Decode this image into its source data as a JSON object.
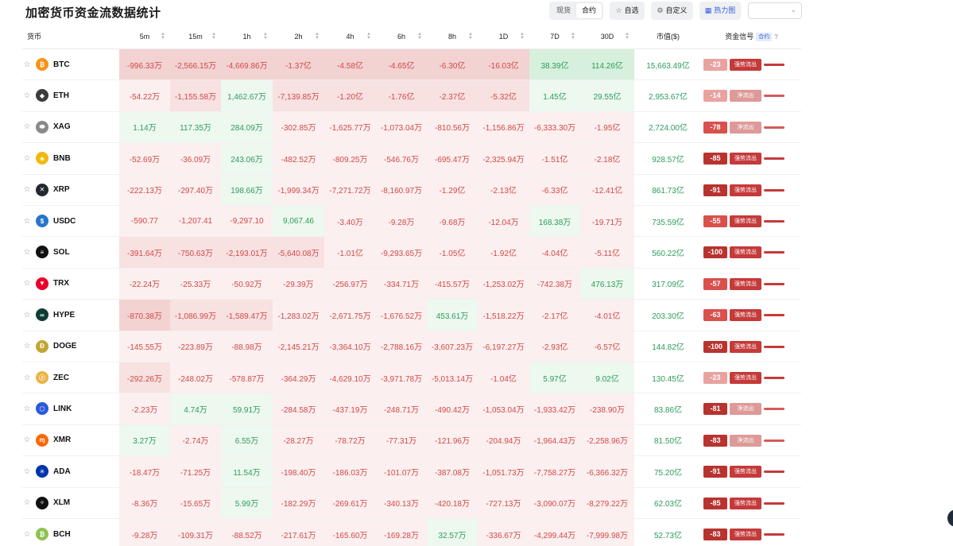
{
  "title": "加密货币资金流数据统计",
  "toolbar": {
    "seg_spot": "现货",
    "seg_contract": "合约",
    "favorites": "自选",
    "custom": "自定义",
    "heatmap": "热力图",
    "dropdown_value": ""
  },
  "columns": [
    "货币",
    "5m",
    "15m",
    "1h",
    "2h",
    "4h",
    "6h",
    "8h",
    "1D",
    "7D",
    "30D",
    "市值($)",
    "资金信号"
  ],
  "signal_badge": "合约",
  "signal_help": "?",
  "rows": [
    {
      "sym": "BTC",
      "icon": "btc",
      "color": "#f7931a",
      "v": [
        "-996.33万",
        "-2,566.15万",
        "-4,669.86万",
        "-1.37亿",
        "-4.58亿",
        "-4.65亿",
        "-6.30亿",
        "-16.03亿",
        "38.39亿",
        "114.26亿"
      ],
      "cap": "15,663.49亿",
      "score": "-23",
      "tag": "强势流出",
      "strong": true
    },
    {
      "sym": "ETH",
      "icon": "eth",
      "color": "#3c3c3d",
      "v": [
        "-54.22万",
        "-1,155.58万",
        "1,462.67万",
        "-7,139.85万",
        "-1.20亿",
        "-1.76亿",
        "-2.37亿",
        "-5.32亿",
        "1.45亿",
        "29.55亿"
      ],
      "cap": "2,953.67亿",
      "score": "-14",
      "tag": "净流出",
      "strong": false
    },
    {
      "sym": "XAG",
      "icon": "xag",
      "color": "#8a8a8a",
      "v": [
        "1.14万",
        "117.35万",
        "284.09万",
        "-302.85万",
        "-1,625.77万",
        "-1,073.04万",
        "-810.56万",
        "-1,156.86万",
        "-6,333.30万",
        "-1.95亿"
      ],
      "cap": "2,724.00亿",
      "score": "-78",
      "tag": "净流出",
      "strong": false
    },
    {
      "sym": "BNB",
      "icon": "bnb",
      "color": "#f0b90b",
      "v": [
        "-52.69万",
        "-36.09万",
        "243.06万",
        "-482.52万",
        "-809.25万",
        "-546.76万",
        "-695.47万",
        "-2,325.94万",
        "-1.51亿",
        "-2.18亿"
      ],
      "cap": "928.57亿",
      "score": "-85",
      "tag": "强势流出",
      "strong": true
    },
    {
      "sym": "XRP",
      "icon": "xrp",
      "color": "#23292f",
      "v": [
        "-222.13万",
        "-297.40万",
        "198.66万",
        "-1,999.34万",
        "-7,271.72万",
        "-8,160.97万",
        "-1.29亿",
        "-2.13亿",
        "-6.33亿",
        "-12.41亿"
      ],
      "cap": "861.73亿",
      "score": "-91",
      "tag": "强势流出",
      "strong": true
    },
    {
      "sym": "USDC",
      "icon": "usdc",
      "color": "#2775ca",
      "v": [
        "-590.77",
        "-1,207.41",
        "-9,297.10",
        "9,067.46",
        "-3.40万",
        "-9.28万",
        "-9.68万",
        "-12.04万",
        "168.38万",
        "-19.71万"
      ],
      "cap": "735.59亿",
      "score": "-55",
      "tag": "强势流出",
      "strong": true
    },
    {
      "sym": "SOL",
      "icon": "sol",
      "color": "#111111",
      "v": [
        "-391.64万",
        "-750.63万",
        "-2,193.01万",
        "-5,640.08万",
        "-1.01亿",
        "-9,293.65万",
        "-1.05亿",
        "-1.92亿",
        "-4.04亿",
        "-5.11亿"
      ],
      "cap": "560.22亿",
      "score": "-100",
      "tag": "强势流出",
      "strong": true
    },
    {
      "sym": "TRX",
      "icon": "trx",
      "color": "#eb0029",
      "v": [
        "-22.24万",
        "-25.33万",
        "-50.92万",
        "-29.39万",
        "-256.97万",
        "-334.71万",
        "-415.57万",
        "-1,253.02万",
        "-742.38万",
        "476.13万"
      ],
      "cap": "317.09亿",
      "score": "-57",
      "tag": "强势流出",
      "strong": true
    },
    {
      "sym": "HYPE",
      "icon": "hype",
      "color": "#0f3d36",
      "v": [
        "-870.38万",
        "-1,086.99万",
        "-1,589.47万",
        "-1,283.02万",
        "-2,671.75万",
        "-1,676.52万",
        "453.61万",
        "-1,518.22万",
        "-2.17亿",
        "-4.01亿"
      ],
      "cap": "203.30亿",
      "score": "-63",
      "tag": "强势流出",
      "strong": true
    },
    {
      "sym": "DOGE",
      "icon": "doge",
      "color": "#c2a633",
      "v": [
        "-145.55万",
        "-223.89万",
        "-88.98万",
        "-2,145.21万",
        "-3,364.10万",
        "-2,788.16万",
        "-3,607.23万",
        "-6,197.27万",
        "-2.93亿",
        "-6.57亿"
      ],
      "cap": "144.82亿",
      "score": "-100",
      "tag": "强势流出",
      "strong": true
    },
    {
      "sym": "ZEC",
      "icon": "zec",
      "color": "#ecb244",
      "v": [
        "-292.26万",
        "-248.02万",
        "-578.87万",
        "-364.29万",
        "-4,629.10万",
        "-3,971.78万",
        "-5,013.14万",
        "-1.04亿",
        "5.97亿",
        "9.02亿"
      ],
      "cap": "130.45亿",
      "score": "-23",
      "tag": "强势流出",
      "strong": true
    },
    {
      "sym": "LINK",
      "icon": "link",
      "color": "#2a5ada",
      "v": [
        "-2.23万",
        "4.74万",
        "59.91万",
        "-284.58万",
        "-437.19万",
        "-248.71万",
        "-490.42万",
        "-1,053.04万",
        "-1,933.42万",
        "-238.90万"
      ],
      "cap": "83.86亿",
      "score": "-81",
      "tag": "净流出",
      "strong": false
    },
    {
      "sym": "XMR",
      "icon": "xmr",
      "color": "#ff6600",
      "v": [
        "3.27万",
        "-2.74万",
        "6.55万",
        "-28.27万",
        "-78.72万",
        "-77.31万",
        "-121.96万",
        "-204.94万",
        "-1,964.43万",
        "-2,258.96万"
      ],
      "cap": "81.50亿",
      "score": "-83",
      "tag": "净流出",
      "strong": false
    },
    {
      "sym": "ADA",
      "icon": "ada",
      "color": "#0033ad",
      "v": [
        "-18.47万",
        "-71.25万",
        "11.54万",
        "-198.40万",
        "-186.03万",
        "-101.07万",
        "-387.08万",
        "-1,051.73万",
        "-7,758.27万",
        "-6,366.32万"
      ],
      "cap": "75.20亿",
      "score": "-91",
      "tag": "强势流出",
      "strong": true
    },
    {
      "sym": "XLM",
      "icon": "xlm",
      "color": "#111111",
      "v": [
        "-8.36万",
        "-15.65万",
        "5.99万",
        "-182.29万",
        "-269.61万",
        "-340.13万",
        "-420.18万",
        "-727.13万",
        "-3,090.07万",
        "-8,279.22万"
      ],
      "cap": "62.03亿",
      "score": "-85",
      "tag": "强势流出",
      "strong": true
    },
    {
      "sym": "BCH",
      "icon": "bch",
      "color": "#8dc351",
      "v": [
        "-9.28万",
        "-109.31万",
        "-88.52万",
        "-217.61万",
        "-165.60万",
        "-169.28万",
        "32.57万",
        "-336.67万",
        "-4,299.44万",
        "-7,999.98万"
      ],
      "cap": "52.73亿",
      "score": "-83",
      "tag": "强势流出",
      "strong": true
    }
  ],
  "heat_colors": {
    "neg_strong": "#f3d2d2",
    "neg_mid": "#f8e1e1",
    "neg_light": "#fcefef",
    "pos_strong": "#d7f0dd",
    "pos_light": "#edf8ef",
    "score_strong": "#b8332f",
    "score_mid": "#d9504c",
    "score_light": "#e8a3a0",
    "tag_strong": "#c53a3a",
    "tag_light": "#dd9a98"
  }
}
